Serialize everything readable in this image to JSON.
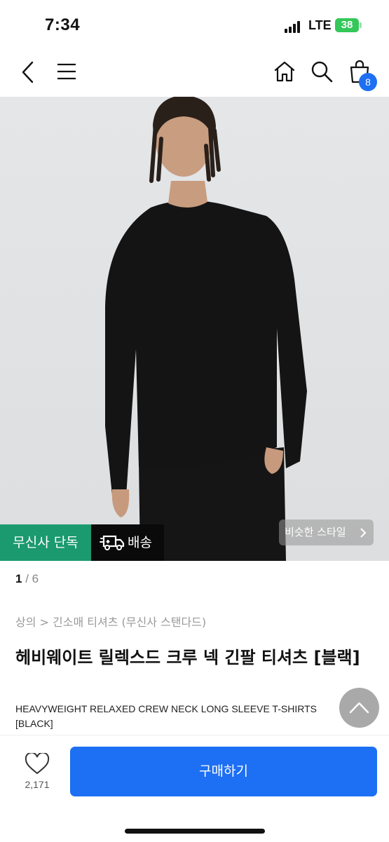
{
  "status_bar": {
    "time": "7:34",
    "network": "LTE",
    "battery": "38"
  },
  "nav": {
    "cart_count": "8"
  },
  "gallery": {
    "exclusive_label": "무신사 단독",
    "delivery_label": "배송",
    "similar_style_label": "비슷한 스타일",
    "current_page": "1",
    "total_pages": "/ 6"
  },
  "product": {
    "breadcrumb": "상의 > 긴소매 티셔츠 (무신사 스탠다드)",
    "title_ko": "헤비웨이트 릴렉스드 크루 넥 긴팔 티셔츠 [블랙]",
    "title_en": "HEAVYWEIGHT RELAXED CREW NECK LONG SLEEVE T-SHIRTS [BLACK]"
  },
  "bottom": {
    "like_count": "2,171",
    "buy_label": "구매하기"
  },
  "colors": {
    "accent_blue": "#1d6ff3",
    "exclusive_green": "#1a9a6e",
    "delivery_black": "#0a0a0a"
  },
  "icons": [
    "back-arrow-icon",
    "menu-icon",
    "home-icon",
    "search-icon",
    "cart-icon",
    "truck-icon",
    "chevron-right-icon",
    "chevron-up-icon",
    "heart-icon"
  ]
}
